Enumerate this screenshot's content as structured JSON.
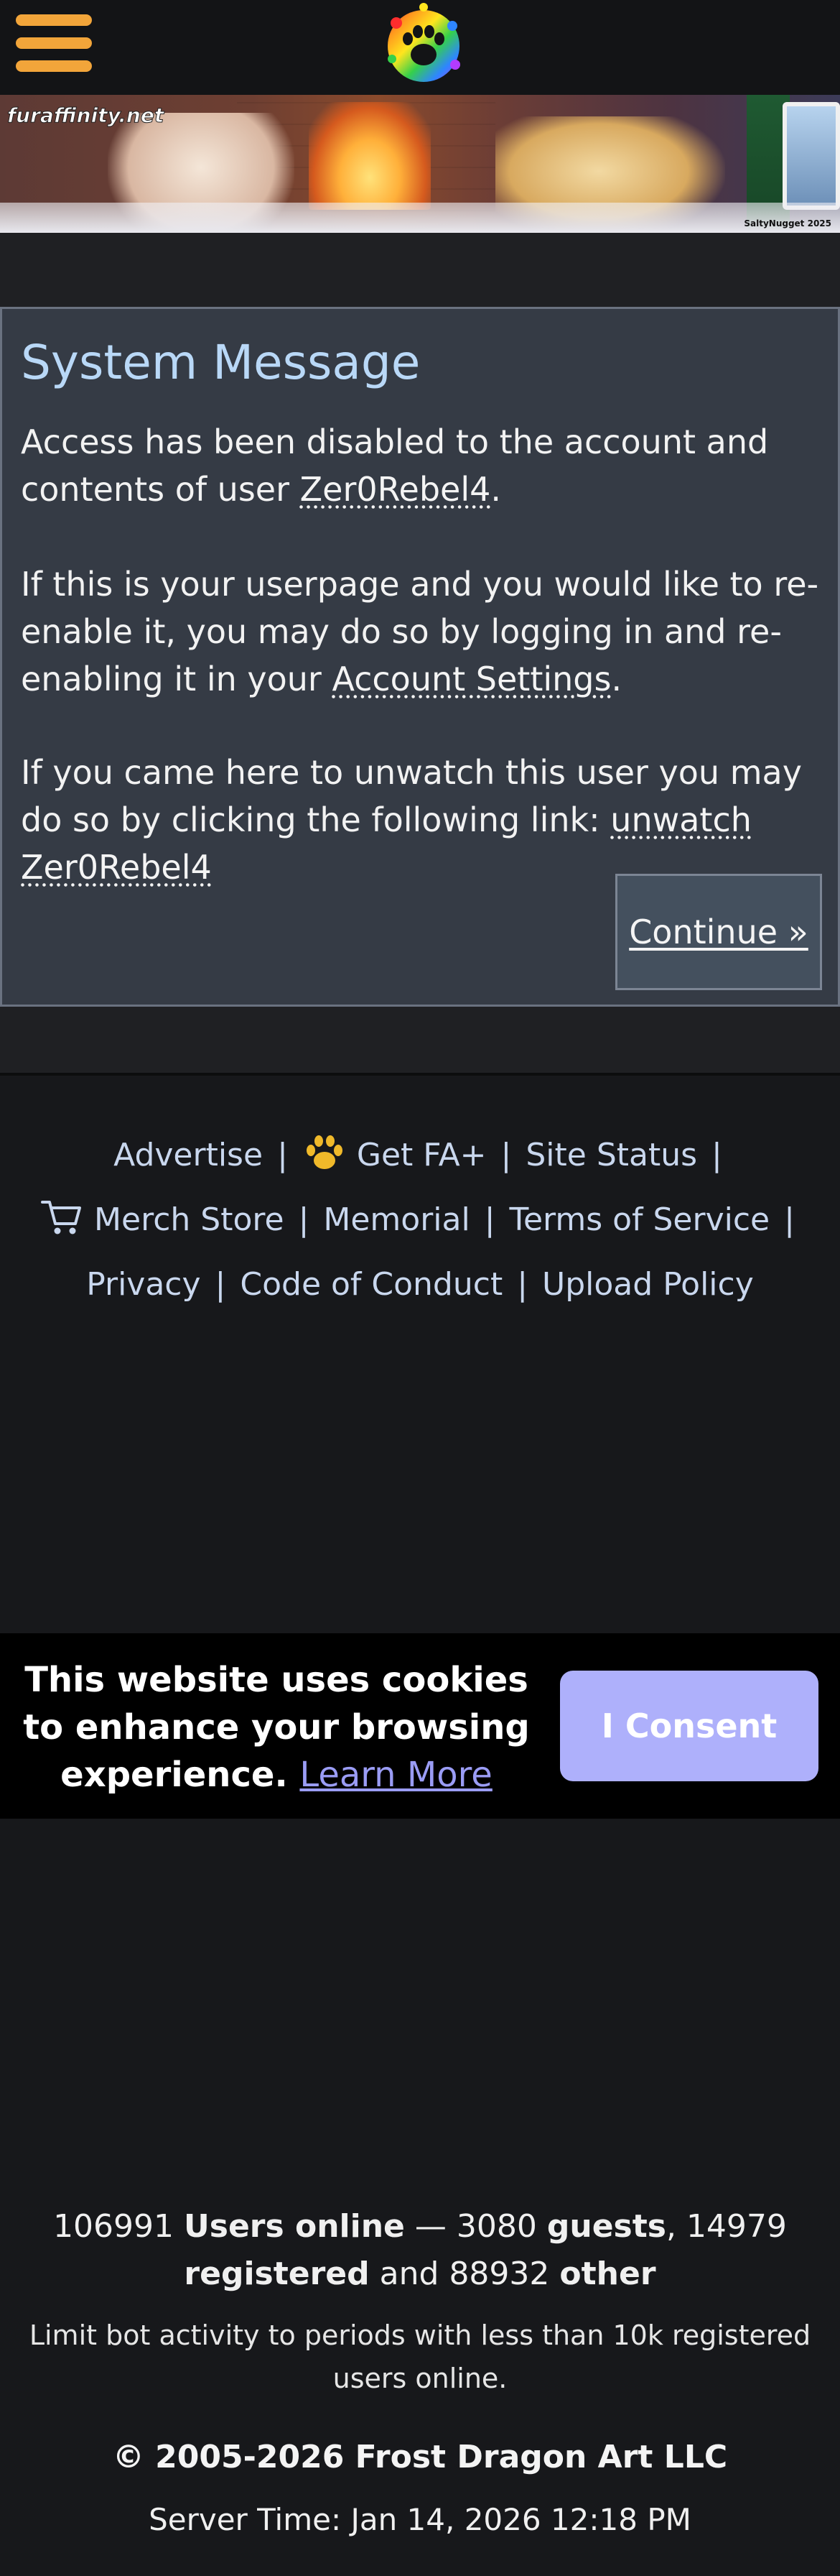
{
  "header": {
    "menu_icon": "hamburger-menu-icon",
    "logo_icon": "rainbow-paw-logo-icon",
    "menu_color": "#f2a53a"
  },
  "banner": {
    "site_tag": "furaffinity.net",
    "credit": "SaltyNugget 2025"
  },
  "system_message": {
    "title": "System Message",
    "p1_before": "Access has been disabled to the account and contents of user ",
    "p1_link": "Zer0Rebel4",
    "p1_after": ".",
    "p2_before": "If this is your userpage and you would like to re-enable it, you may do so by logging in and re-enabling it in your ",
    "p2_link": "Account Settings",
    "p2_after": ".",
    "p3_before": "If you came here to unwatch this user you may do so by clicking the following link: ",
    "p3_link": "unwatch Zer0Rebel4",
    "continue_label": "Continue »",
    "title_color": "#b9d8f7"
  },
  "footer": {
    "links": {
      "advertise": "Advertise",
      "get_fa_plus": "Get FA+",
      "site_status": "Site Status",
      "merch_store": "Merch Store",
      "memorial": "Memorial",
      "terms": "Terms of Service",
      "privacy": "Privacy",
      "code_of_conduct": "Code of Conduct",
      "upload_policy": "Upload Policy"
    },
    "separator": "|",
    "icons": {
      "fa_plus": "gold-paw-icon",
      "merch": "shopping-cart-icon"
    }
  },
  "cookie": {
    "message": "This website uses cookies to enhance your browsing experience.",
    "learn_more": "Learn More",
    "consent_label": "I Consent",
    "consent_color": "#aeb0fb"
  },
  "stats": {
    "total": "106991",
    "users_online_label": "Users online",
    "dash": "—",
    "guests": "3080",
    "guests_label": "guests",
    "registered": "14979",
    "registered_label": "registered",
    "and": "and",
    "other": "88932",
    "other_label": "other",
    "bot_note": "Limit bot activity to periods with less than 10k registered users online."
  },
  "copyright": "© 2005-2026 Frost Dragon Art LLC",
  "server_time": "Server Time: Jan 14, 2026 12:18 PM"
}
